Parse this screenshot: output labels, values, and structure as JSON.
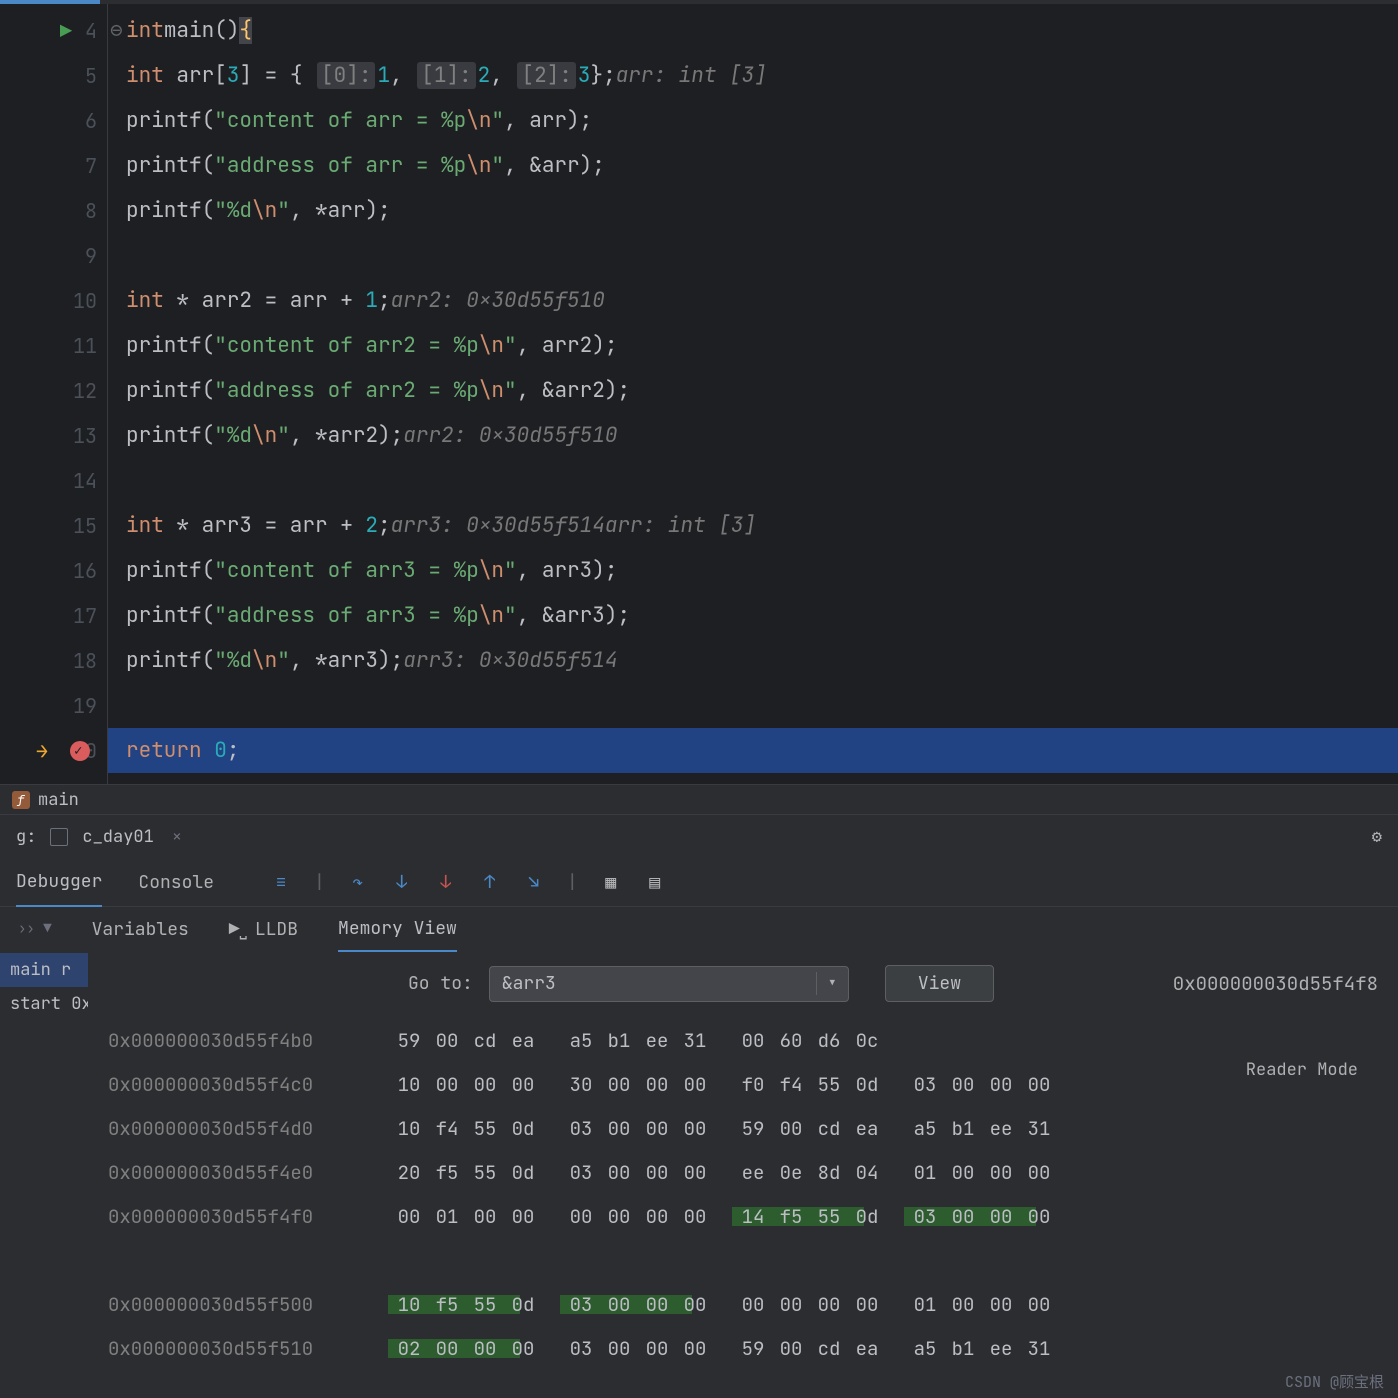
{
  "line_numbers": [
    "4",
    "5",
    "6",
    "7",
    "8",
    "9",
    "10",
    "11",
    "12",
    "13",
    "14",
    "15",
    "16",
    "17",
    "18",
    "19",
    "20"
  ],
  "code": {
    "l4": {
      "kw": "int",
      "fn": "main",
      "paren": "()",
      "brace": "{"
    },
    "l5": {
      "kw": "int",
      "var": " arr[",
      "num1": "3",
      "mid": "] = { ",
      "idx0": "[0]:",
      "v0": "1",
      "s1": ", ",
      "idx1": "[1]:",
      "v1": "2",
      "s2": ", ",
      "idx2": "[2]:",
      "v2": "3",
      "end": "};",
      "hint": "arr: int [3]"
    },
    "l6": {
      "fn": "printf",
      "open": "(",
      "str1": "\"content of arr = %p",
      "esc": "\\n",
      "str2": "\"",
      "args": ", arr);"
    },
    "l7": {
      "fn": "printf",
      "open": "(",
      "str1": "\"address of arr = %p",
      "esc": "\\n",
      "str2": "\"",
      "args": ", &arr);"
    },
    "l8": {
      "fn": "printf",
      "open": "(",
      "str1": "\"%d",
      "esc": "\\n",
      "str2": "\"",
      "args": ", *arr);"
    },
    "l10": {
      "kw": "int",
      "decl": " * arr2 = arr + ",
      "num": "1",
      "semi": ";",
      "hint": "arr2: 0x30d55f510"
    },
    "l11": {
      "fn": "printf",
      "open": "(",
      "str1": "\"content of arr2 = %p",
      "esc": "\\n",
      "str2": "\"",
      "args": ", arr2);"
    },
    "l12": {
      "fn": "printf",
      "open": "(",
      "str1": "\"address of arr2 = %p",
      "esc": "\\n",
      "str2": "\"",
      "args": ", &arr2);"
    },
    "l13": {
      "fn": "printf",
      "open": "(",
      "str1": "\"%d",
      "esc": "\\n",
      "str2": "\"",
      "args": ", *arr2);",
      "hint": "arr2: 0x30d55f510"
    },
    "l15": {
      "kw": "int",
      "decl": " * arr3 = arr + ",
      "num": "2",
      "semi": ";",
      "hint": "arr3: 0x30d55f514",
      "hint2": "arr: int [3]"
    },
    "l16": {
      "fn": "printf",
      "open": "(",
      "str1": "\"content of arr3 = %p",
      "esc": "\\n",
      "str2": "\"",
      "args": ", arr3);"
    },
    "l17": {
      "fn": "printf",
      "open": "(",
      "str1": "\"address of arr3 = %p",
      "esc": "\\n",
      "str2": "\"",
      "args": ", &arr3);"
    },
    "l18": {
      "fn": "printf",
      "open": "(",
      "str1": "\"%d",
      "esc": "\\n",
      "str2": "\"",
      "args": ", *arr3);",
      "hint": "arr3: 0x30d55f514"
    },
    "l20": {
      "kw": "return",
      "sp": " ",
      "num": "0",
      "semi": ";"
    }
  },
  "breadcrumb": {
    "fn": "main"
  },
  "tool_window": {
    "label": "g:",
    "tab": "c_day01"
  },
  "debug_tabs": {
    "debugger": "Debugger",
    "console": "Console"
  },
  "sub_tabs": {
    "variables": "Variables",
    "lldb": "LLDB",
    "memory": "Memory View"
  },
  "frames": {
    "main": "main r",
    "start": "start 0x"
  },
  "memory": {
    "goto_label": "Go to:",
    "goto_value": "&arr3",
    "view": "View",
    "cursor": "0x000000030d55f4f8",
    "reader": "Reader Mode",
    "rows": [
      {
        "addr": "0x000000030d55f4b0",
        "g": [
          [
            "59",
            "00",
            "cd",
            "ea"
          ],
          [
            "a5",
            "b1",
            "ee",
            "31"
          ],
          [
            "00",
            "60",
            "d6",
            "0c"
          ],
          [
            "",
            "",
            "",
            ""
          ]
        ]
      },
      {
        "addr": "0x000000030d55f4c0",
        "g": [
          [
            "10",
            "00",
            "00",
            "00"
          ],
          [
            "30",
            "00",
            "00",
            "00"
          ],
          [
            "f0",
            "f4",
            "55",
            "0d"
          ],
          [
            "03",
            "00",
            "00",
            "00"
          ]
        ]
      },
      {
        "addr": "0x000000030d55f4d0",
        "g": [
          [
            "10",
            "f4",
            "55",
            "0d"
          ],
          [
            "03",
            "00",
            "00",
            "00"
          ],
          [
            "59",
            "00",
            "cd",
            "ea"
          ],
          [
            "a5",
            "b1",
            "ee",
            "31"
          ]
        ]
      },
      {
        "addr": "0x000000030d55f4e0",
        "g": [
          [
            "20",
            "f5",
            "55",
            "0d"
          ],
          [
            "03",
            "00",
            "00",
            "00"
          ],
          [
            "ee",
            "0e",
            "8d",
            "04"
          ],
          [
            "01",
            "00",
            "00",
            "00"
          ]
        ]
      },
      {
        "addr": "0x000000030d55f4f0",
        "g": [
          [
            "00",
            "01",
            "00",
            "00"
          ],
          [
            "00",
            "00",
            "00",
            "00"
          ],
          [
            "14",
            "f5",
            "55",
            "0d"
          ],
          [
            "03",
            "00",
            "00",
            "00"
          ]
        ],
        "hl": [
          2,
          3
        ]
      },
      {
        "addr": "",
        "g": [
          [
            "",
            "",
            "",
            ""
          ],
          [
            "",
            "",
            "",
            ""
          ],
          [
            "",
            "",
            "",
            ""
          ],
          [
            "",
            "",
            "",
            ""
          ]
        ]
      },
      {
        "addr": "0x000000030d55f500",
        "g": [
          [
            "10",
            "f5",
            "55",
            "0d"
          ],
          [
            "03",
            "00",
            "00",
            "00"
          ],
          [
            "00",
            "00",
            "00",
            "00"
          ],
          [
            "01",
            "00",
            "00",
            "00"
          ]
        ],
        "hl": [
          0,
          1
        ]
      },
      {
        "addr": "0x000000030d55f510",
        "g": [
          [
            "02",
            "00",
            "00",
            "00"
          ],
          [
            "03",
            "00",
            "00",
            "00"
          ],
          [
            "59",
            "00",
            "cd",
            "ea"
          ],
          [
            "a5",
            "b1",
            "ee",
            "31"
          ]
        ],
        "hl": [
          0
        ]
      }
    ]
  },
  "watermark": "CSDN @顾宝根"
}
